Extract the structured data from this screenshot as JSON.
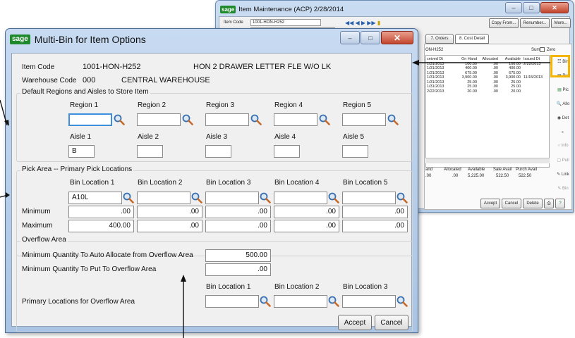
{
  "bg_window": {
    "title": "Item Maintenance (ACP) 2/28/2014",
    "item_code_label": "Item Code",
    "item_code_value": "1001-HON-H252",
    "copy_from": "Copy From...",
    "renumber": "Renumber...",
    "more": "More...",
    "tabs": [
      "7. Orders",
      "8. Cost Detail"
    ],
    "item_short": "ON-H252",
    "sum_label": "Sum",
    "zero_label": "Zero",
    "col_headers": [
      "ceived Dt",
      "On Hand",
      "Allocated",
      "Available",
      "Issued Dt"
    ],
    "col_received": [
      "1/31/2013",
      "1/31/2013",
      "1/31/2013",
      "1/31/2013",
      "1/31/2013",
      "1/31/2013",
      "2/22/2013"
    ],
    "col_onhand": [
      "100.00",
      "400.00",
      "675.00",
      "3,900.00",
      "25.00",
      "25.00",
      "20.00"
    ],
    "col_alloc": [
      ".00",
      ".00",
      ".00",
      ".00",
      ".00",
      ".00",
      ".00"
    ],
    "col_avail": [
      "100.00",
      "400.00",
      "675.00",
      "3,900.00",
      "25.00",
      "25.00",
      "20.00"
    ],
    "col_issued": [
      "2/22/2013",
      "",
      "",
      "11/15/2013",
      "",
      "",
      ""
    ],
    "side_buttons": [
      "Bin",
      "Pul",
      "Pic",
      "Allo",
      "Det",
      "",
      "Info",
      "Pull",
      "Link",
      "Bin"
    ],
    "totals_headers": [
      "and",
      "Allocated",
      "Available",
      "Sale Avail",
      "Purch Avail"
    ],
    "totals_values": [
      ".00",
      ".00",
      "5,225.00",
      "522.50",
      "522.50"
    ],
    "bottom_buttons": [
      "Accept",
      "Cancel",
      "Delete"
    ]
  },
  "dialog": {
    "title": "Multi-Bin for Item Options",
    "item_code_label": "Item Code",
    "item_code": "1001-HON-H252",
    "item_desc": "HON 2 DRAWER LETTER FLE W/O LK",
    "warehouse_label": "Warehouse Code",
    "warehouse_code": "000",
    "warehouse_desc": "CENTRAL WAREHOUSE",
    "regions_group": "Default Regions and Aisles to Store Item",
    "region_labels": [
      "Region 1",
      "Region 2",
      "Region 3",
      "Region 4",
      "Region 5"
    ],
    "region_values": [
      "",
      "",
      "",
      "",
      ""
    ],
    "aisle_labels": [
      "Aisle 1",
      "Aisle 2",
      "Aisle 3",
      "Aisle 4",
      "Aisle 5"
    ],
    "aisle_values": [
      "B",
      "",
      "",
      "",
      ""
    ],
    "pick_group": "Pick Area -- Primary Pick Locations",
    "bin_labels": [
      "Bin Location 1",
      "Bin Location 2",
      "Bin Location 3",
      "Bin Location 4",
      "Bin Location 5"
    ],
    "bin_values": [
      "A10L",
      "",
      "",
      "",
      ""
    ],
    "minimum_label": "Minimum",
    "minimum_values": [
      ".00",
      ".00",
      ".00",
      ".00",
      ".00"
    ],
    "maximum_label": "Maximum",
    "maximum_values": [
      "400.00",
      ".00",
      ".00",
      ".00",
      ".00"
    ],
    "overflow_group": "Overflow Area",
    "min_alloc_label": "Minimum Quantity To Auto Allocate from Overflow Area",
    "min_alloc_value": "500.00",
    "min_put_label": "Minimum Quantity To Put To Overflow Area",
    "min_put_value": ".00",
    "overflow_bin_labels": [
      "Bin Location 1",
      "Bin Location 2",
      "Bin Location 3"
    ],
    "overflow_bin_values": [
      "",
      "",
      ""
    ],
    "primary_overflow_label": "Primary Locations for Overflow Area",
    "accept": "Accept",
    "cancel": "Cancel"
  },
  "colors": {
    "accent": "#3c8fdc",
    "highlight": "#f4b400",
    "sage": "#1f8a2c"
  }
}
